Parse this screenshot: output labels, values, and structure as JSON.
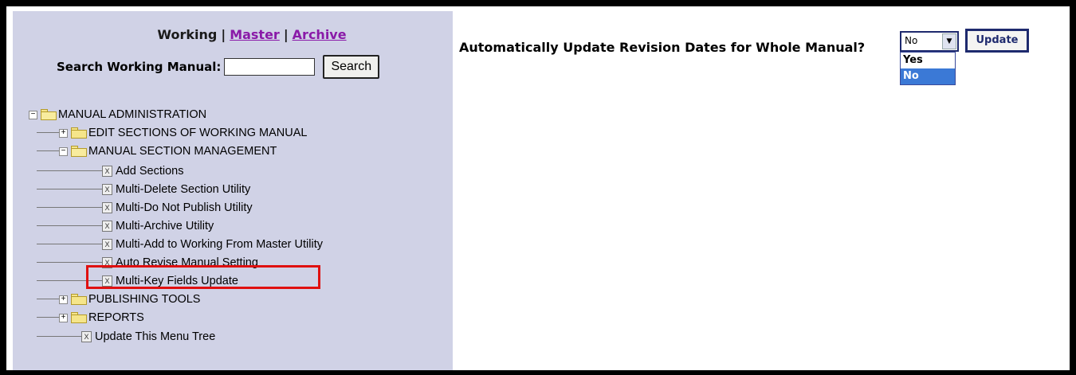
{
  "nav": {
    "working": "Working",
    "master": "Master",
    "archive": "Archive",
    "sep": "|"
  },
  "search": {
    "label": "Search Working Manual:",
    "button": "Search",
    "value": ""
  },
  "tree": {
    "root": "MANUAL ADMINISTRATION",
    "edit_sections": "EDIT SECTIONS OF WORKING MANUAL",
    "section_mgmt": "MANUAL SECTION MANAGEMENT",
    "items": [
      "Add Sections",
      "Multi-Delete Section Utility",
      "Multi-Do Not Publish Utility",
      "Multi-Archive Utility",
      "Multi-Add to Working From Master Utility",
      "Auto Revise Manual Setting",
      "Multi-Key Fields Update"
    ],
    "publishing": "PUBLISHING TOOLS",
    "reports": "REPORTS",
    "update_tree": "Update This Menu Tree"
  },
  "main": {
    "question": "Automatically Update Revision Dates for Whole Manual?",
    "select_value": "No",
    "options": [
      "Yes",
      "No"
    ],
    "update_button": "Update"
  },
  "colors": {
    "panel": "#d0d2e6",
    "link": "#8a1aa8",
    "highlight": "#e01010",
    "selected_option": "#3b79d6"
  }
}
